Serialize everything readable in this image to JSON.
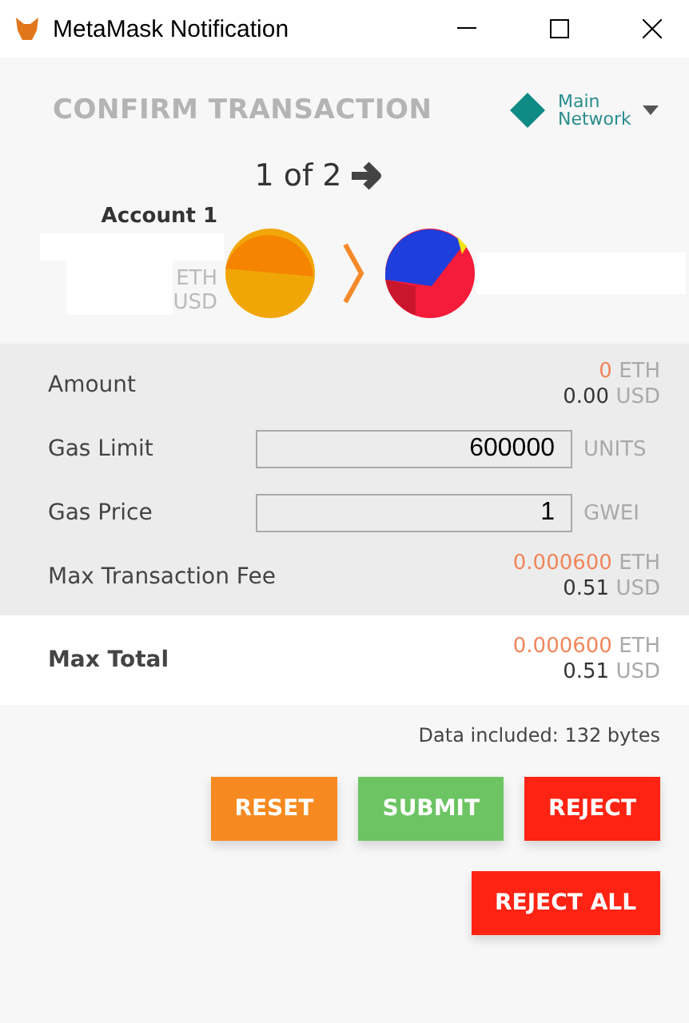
{
  "window": {
    "title": "MetaMask Notification"
  },
  "header": {
    "title": "CONFIRM TRANSACTION",
    "network": [
      "Main",
      "Network"
    ]
  },
  "pager": {
    "text": "1 of 2"
  },
  "from": {
    "account": "Account 1",
    "units": [
      "ETH",
      "USD"
    ]
  },
  "rows": [
    {
      "kind": "amount",
      "label": "Amount",
      "eth": "0",
      "eth_unit": "ETH",
      "usd": "0.00",
      "usd_unit": "USD"
    },
    {
      "kind": "input",
      "label": "Gas Limit",
      "value": "600000",
      "unit": "UNITS"
    },
    {
      "kind": "input",
      "label": "Gas Price",
      "value": "1",
      "unit": "GWEI"
    },
    {
      "kind": "amount",
      "label": "Max Transaction Fee",
      "eth": "0.000600",
      "eth_unit": "ETH",
      "usd": "0.51",
      "usd_unit": "USD"
    }
  ],
  "total": {
    "label": "Max Total",
    "eth": "0.000600",
    "eth_unit": "ETH",
    "usd": "0.51",
    "usd_unit": "USD"
  },
  "data_note": "Data included: 132 bytes",
  "buttons": [
    {
      "label": "RESET",
      "color": "#f6891f"
    },
    {
      "label": "SUBMIT",
      "color": "#6cc463"
    },
    {
      "label": "REJECT",
      "color": "#ff2314"
    }
  ],
  "reject_all": {
    "label": "REJECT ALL",
    "color": "#ff2314"
  }
}
